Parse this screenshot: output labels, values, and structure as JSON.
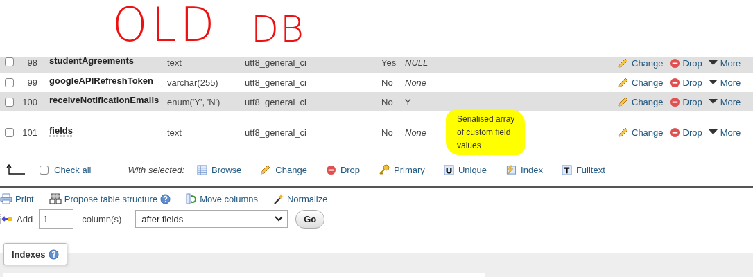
{
  "annotation": {
    "words": [
      "OLD",
      "DB"
    ]
  },
  "columns": [
    {
      "number": "98",
      "name": "studentAgreements",
      "type": "text",
      "collation": "utf8_general_ci",
      "null": "Yes",
      "default": "NULL",
      "default_keyword": true,
      "checked": false,
      "actions": [
        "Change",
        "Drop",
        "More"
      ]
    },
    {
      "number": "99",
      "name": "googleAPIRefreshToken",
      "type": "varchar(255)",
      "collation": "utf8_general_ci",
      "null": "No",
      "default": "None",
      "default_keyword": true,
      "checked": false,
      "actions": [
        "Change",
        "Drop",
        "More"
      ]
    },
    {
      "number": "100",
      "name": "receiveNotificationEmails",
      "type": "enum('Y', 'N')",
      "collation": "utf8_general_ci",
      "null": "No",
      "default": "Y",
      "default_keyword": false,
      "checked": false,
      "actions": [
        "Change",
        "Drop",
        "More"
      ]
    },
    {
      "number": "101",
      "name": "fields",
      "type": "text",
      "collation": "utf8_general_ci",
      "null": "No",
      "default": "None",
      "default_keyword": true,
      "checked": false,
      "comment": "Serialised array of custom field values",
      "comment_highlighted": true,
      "actions": [
        "Change",
        "Drop",
        "More"
      ]
    }
  ],
  "bulk": {
    "check_all": {
      "label": "Check all",
      "checked": false
    },
    "with_selected": "With selected:",
    "actions": [
      {
        "label": "Browse",
        "kind": "browse"
      },
      {
        "label": "Change",
        "kind": "change"
      },
      {
        "label": "Drop",
        "kind": "drop"
      },
      {
        "label": "Primary",
        "kind": "primary"
      },
      {
        "label": "Unique",
        "kind": "unique"
      },
      {
        "label": "Index",
        "kind": "index"
      },
      {
        "label": "Fulltext",
        "kind": "fulltext"
      }
    ]
  },
  "tools": [
    {
      "label": "Print",
      "kind": "print",
      "help": false
    },
    {
      "label": "Propose table structure",
      "kind": "propose",
      "help": true
    },
    {
      "label": "Move columns",
      "kind": "move",
      "help": false
    },
    {
      "label": "Normalize",
      "kind": "normalize",
      "help": false
    }
  ],
  "add_columns": {
    "label": "Add",
    "count": "1",
    "unit": "column(s)",
    "position": "after fields",
    "button": "Go"
  },
  "indexes_tab": {
    "label": "Indexes",
    "help": true
  }
}
